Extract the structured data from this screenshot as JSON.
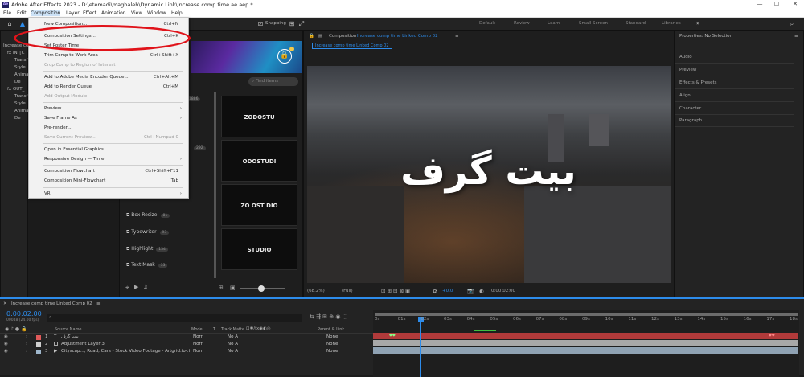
{
  "window": {
    "title": "Adobe After Effects 2023 - D:\\etemadi\\maghaleh\\Dynamic Link\\Increase comp time ae.aep *",
    "logo": "Ae",
    "min": "—",
    "max": "☐",
    "close": "✕"
  },
  "menubar": [
    "File",
    "Edit",
    "Composition",
    "Layer",
    "Effect",
    "Animation",
    "View",
    "Window",
    "Help"
  ],
  "toolbar": {
    "snapping": "Snapping",
    "workspaces": [
      "Default",
      "Review",
      "Learn",
      "Small Screen",
      "Standard",
      "Libraries"
    ],
    "more": "»"
  },
  "dropdown": {
    "items": [
      {
        "label": "New Composition...",
        "shortcut": "Ctrl+N",
        "disabled": false
      },
      {
        "label": "Composition Settings...",
        "shortcut": "Ctrl+K",
        "disabled": false
      },
      {
        "label": "Set Poster Time",
        "shortcut": "",
        "disabled": false
      },
      {
        "label": "Trim Comp to Work Area",
        "shortcut": "Ctrl+Shift+X",
        "disabled": false
      },
      {
        "label": "Crop Comp to Region of Interest",
        "shortcut": "",
        "disabled": true
      },
      {
        "label": "Add to Adobe Media Encoder Queue...",
        "shortcut": "Ctrl+Alt+M",
        "disabled": false
      },
      {
        "label": "Add to Render Queue",
        "shortcut": "Ctrl+M",
        "disabled": false
      },
      {
        "label": "Add Output Module",
        "shortcut": "",
        "disabled": true
      },
      {
        "label": "Preview",
        "shortcut": "",
        "disabled": false,
        "submenu": true
      },
      {
        "label": "Save Frame As",
        "shortcut": "",
        "disabled": false,
        "submenu": true
      },
      {
        "label": "Pre-render...",
        "shortcut": "",
        "disabled": false
      },
      {
        "label": "Save Current Preview...",
        "shortcut": "Ctrl+Numpad 0",
        "disabled": true
      },
      {
        "label": "Open in Essential Graphics",
        "shortcut": "",
        "disabled": false
      },
      {
        "label": "Responsive Design — Time",
        "shortcut": "",
        "disabled": false,
        "submenu": true
      },
      {
        "label": "Composition Flowchart",
        "shortcut": "Ctrl+Shift+F11",
        "disabled": false
      },
      {
        "label": "Composition Mini-Flowchart",
        "shortcut": "Tab",
        "disabled": false
      },
      {
        "label": "VR",
        "shortcut": "",
        "disabled": false,
        "submenu": true
      }
    ]
  },
  "project_panel": {
    "header": "Increase co",
    "rows": [
      "fx  IN_[C",
      "Transf",
      "Style",
      "Anima",
      "De",
      "fx  OUT_",
      "Transf",
      "Style",
      "Anima",
      "De"
    ]
  },
  "effects_panel": {
    "search_placeholder": "Find items",
    "effects": [
      {
        "name": "Box Resize",
        "badge": "81"
      },
      {
        "name": "Typewriter",
        "badge": "93"
      },
      {
        "name": "Highlight",
        "badge": "134"
      },
      {
        "name": "Text Mask",
        "badge": "33"
      }
    ],
    "cards": [
      "ZODOSTU",
      "ODOSTUDI",
      "ZO  OST  DIO",
      "STUDIO"
    ],
    "badges": [
      "1886",
      "292",
      "134"
    ]
  },
  "composition_panel": {
    "label": "Composition",
    "comp_name": "Increase comp time Linked Comp 02",
    "tab": "Increase comp time Linked Comp 02",
    "overlay_text": "بیت گرف",
    "zoom": "(68.2%)",
    "resolution": "(Full)",
    "exposure": "+0.0",
    "timecode": "0:00:02:00"
  },
  "right_panel": {
    "header": "Properties: No Selection",
    "sections": [
      "Audio",
      "Preview",
      "Effects & Presets",
      "Align",
      "Character",
      "Paragraph"
    ]
  },
  "timeline": {
    "tab": "Increase comp time Linked Comp 02",
    "timecode": "0:00:02:00",
    "fps": "00048 (24.00 fps)",
    "columns": {
      "source": "Source Name",
      "mode": "Mode",
      "t": "T",
      "trkmat": "Track Matte",
      "parent": "Parent & Link"
    },
    "layers": [
      {
        "num": "1",
        "type": "T",
        "name": "بیت گرف",
        "mode": "Norr",
        "trk": "No A",
        "parent": "None",
        "color": "#e05a5a"
      },
      {
        "num": "2",
        "type": "",
        "name": "Adjustment Layer 3",
        "mode": "Norr",
        "trk": "No A",
        "parent": "None",
        "color": "#cfcfcf"
      },
      {
        "num": "3",
        "type": "▶",
        "name": "Cityscap..., Road, Cars - Stock Video Footage - Artgrid.io-.ts",
        "mode": "Norr",
        "trk": "No A",
        "parent": "None",
        "color": "#9fb7cc"
      }
    ],
    "ticks": [
      "0s",
      "01s",
      "02s",
      "03s",
      "04s",
      "05s",
      "06s",
      "07s",
      "08s",
      "09s",
      "10s",
      "11s",
      "12s",
      "13s",
      "14s",
      "15s",
      "16s",
      "17s",
      "18s"
    ]
  },
  "colors": {
    "accent": "#2d8ceb",
    "highlight_circle": "#e0131a",
    "layer1_bar": "#b13a3a",
    "layer2_bar": "#a8a8a8",
    "layer3_bar": "#8fa2b3"
  }
}
